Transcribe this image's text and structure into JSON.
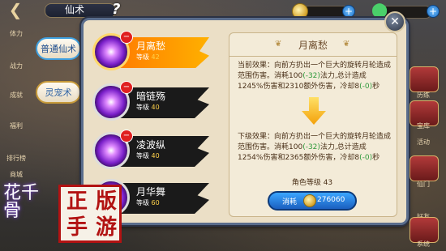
{
  "topbar": {
    "title": "仙术",
    "help_glyph": "?",
    "plus_glyph": "+",
    "back_glyph": "❮"
  },
  "left_tabs": [
    {
      "label": "普通仙术"
    },
    {
      "label": "灵宠术"
    }
  ],
  "left_side_labels": [
    "体力",
    "战力",
    "成就",
    "福利",
    "排行榜",
    "商城"
  ],
  "skills": [
    {
      "name": "月离愁",
      "level_label": "等级",
      "level": "42",
      "badge": "−"
    },
    {
      "name": "暗链殇",
      "level_label": "等级",
      "level": "40",
      "badge": "−"
    },
    {
      "name": "凌波纵",
      "level_label": "等级",
      "level": "40",
      "badge": "−"
    },
    {
      "name": "月华舞",
      "level_label": "等级",
      "level": "60",
      "badge": "−"
    }
  ],
  "detail": {
    "title": "月离愁",
    "current": {
      "prefix": "当前效果：",
      "text1": "向前方扔出一个巨大的旋转月轮造成范围伤害。消耗100",
      "delta": "(-32)",
      "text2": "法力,总计造成1245%伤害和2310额外伤害，冷却8",
      "cd_delta": "(-0)",
      "text3": "秒"
    },
    "next": {
      "prefix": "下级效果：",
      "text1": "向前方扔出一个巨大的旋转月轮造成范围伤害。消耗100",
      "delta": "(-32)",
      "text2": "法力,总计造成1254%伤害和2365额外伤害，冷却8",
      "cd_delta": "(-0)",
      "text3": "秒"
    },
    "role_level": "角色等级 43",
    "consume_label": "消耗",
    "consume_value": "276060"
  },
  "right_side_labels": [
    "历练",
    "宝库",
    "活动",
    "仙门",
    "好友",
    "系统"
  ],
  "logo": {
    "calligraphy": "花千骨",
    "seal_chars": [
      "正",
      "版",
      "手",
      "游"
    ]
  },
  "colors": {
    "selected_ribbon": "#ff8a00",
    "panel_border": "#5a6d8c",
    "consume_button": "#2a7fe0",
    "seal_red": "#b21212"
  }
}
